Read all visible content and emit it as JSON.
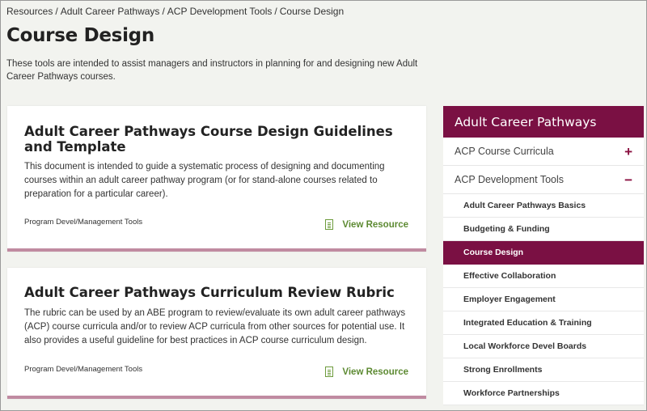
{
  "breadcrumb": [
    "Resources",
    "Adult Career Pathways",
    "ACP Development Tools",
    "Course Design"
  ],
  "page": {
    "title": "Course Design",
    "intro": "These tools are intended to assist managers and instructors in planning for and designing new Adult Career Pathways courses."
  },
  "resources": [
    {
      "title": "Adult Career Pathways Course Design Guidelines and Template",
      "description": "This document is intended to guide a systematic process of designing and documenting courses within an adult career pathway program (or for stand-alone courses related to preparation for a particular career).",
      "tag": "Program Devel/Management Tools",
      "link_label": "View Resource"
    },
    {
      "title": "Adult Career Pathways Curriculum Review Rubric",
      "description": "The rubric can be used by an ABE program to review/evaluate its own adult career pathways (ACP) course curricula and/or to review ACP curricula from other sources for potential use. It also provides a useful guideline for best practices in ACP course curriculum design.",
      "tag": "Program Devel/Management Tools",
      "link_label": "View Resource"
    }
  ],
  "sidebar": {
    "title": "Adult Career Pathways",
    "sections": [
      {
        "label": "ACP Course Curricula",
        "toggle": "+"
      },
      {
        "label": "ACP Development Tools",
        "toggle": "−"
      }
    ],
    "subitems": [
      "Adult Career Pathways Basics",
      "Budgeting & Funding",
      "Course Design",
      "Effective Collaboration",
      "Employer Engagement",
      "Integrated Education & Training",
      "Local Workforce Devel Boards",
      "Strong Enrollments",
      "Workforce Partnerships"
    ]
  },
  "colors": {
    "accent": "#7a1043",
    "link_green": "#5d8a32",
    "card_border": "#c08ba1",
    "background": "#f2f3ef"
  }
}
